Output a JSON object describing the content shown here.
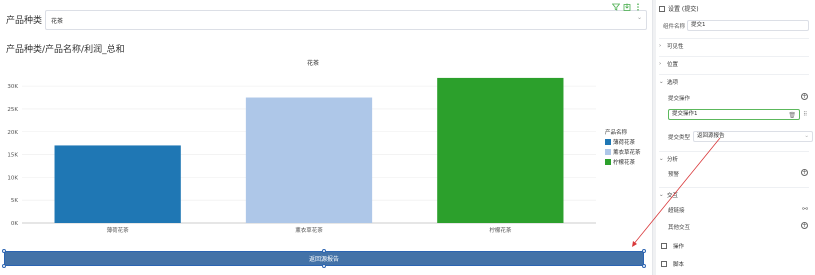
{
  "filter": {
    "label": "产品种类",
    "value": "花茶"
  },
  "chart_title": "产品种类/产品名称/利润_总和",
  "chart_data": {
    "type": "bar",
    "title": "花茶",
    "categories": [
      "薄荷花茶",
      "薰衣草花茶",
      "柠檬花茶"
    ],
    "values": [
      17000,
      27500,
      31800
    ],
    "colors": [
      "#1f77b4",
      "#aec7e8",
      "#2ca02c"
    ],
    "ylim": [
      0,
      32000
    ],
    "yticks": [
      "0K",
      "5K",
      "10K",
      "15K",
      "20K",
      "25K",
      "30K"
    ],
    "legend_title": "产品名称",
    "legend_position": "right",
    "grid": true
  },
  "submit_button": {
    "label": "返回源报告"
  },
  "panel": {
    "header": "设置 (提交)",
    "name_label": "组件名称",
    "name_value": "提交1",
    "sections": {
      "visibility": "可见性",
      "position": "位置",
      "options": "选项",
      "analysis": "分析",
      "interaction": "交互"
    },
    "submit_action_label": "提交操作",
    "submit_action_value": "提交操作1",
    "submit_type_label": "提交类型",
    "submit_type_value": "返回源报告",
    "preview_label": "预警",
    "hyperlink_label": "超链接",
    "other_interaction_label": "其他交互",
    "operation_label": "操作",
    "script_label": "脚本"
  }
}
